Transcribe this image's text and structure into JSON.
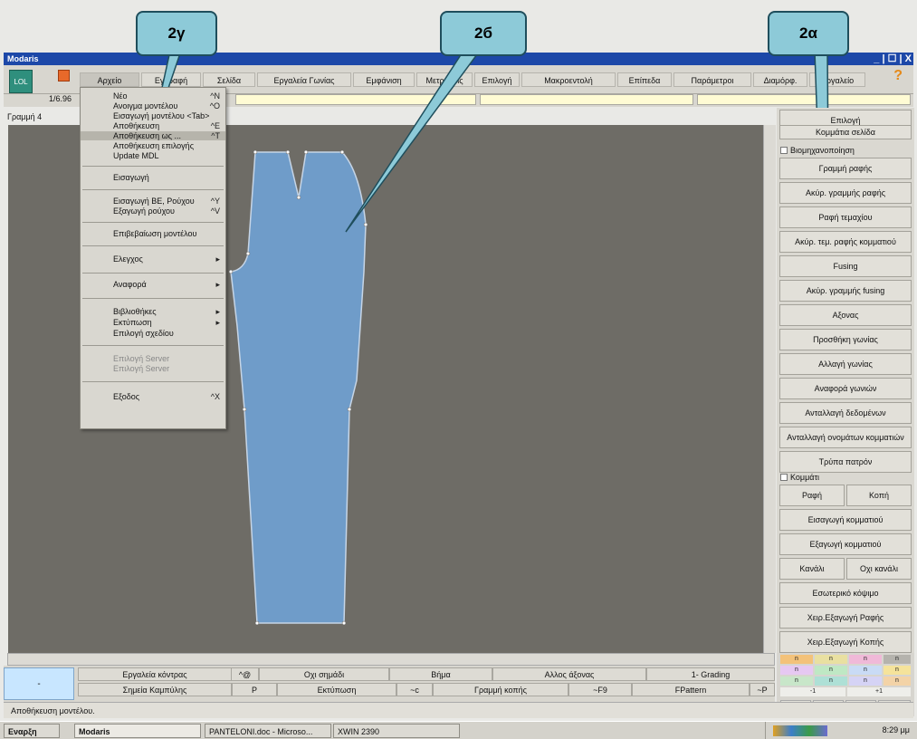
{
  "window": {
    "title": "Modaris",
    "controls": "_ | ☐ | X"
  },
  "menubar": {
    "lol": "LOL",
    "items": [
      "Αρχείο",
      "Εγγραφή",
      "Σελίδα",
      "Εργαλεία Γωνίας",
      "Εμφάνιση",
      "Μετρήσεις",
      "Επιλογή",
      "Μακροεντολή",
      "Επίπεδα",
      "Παράμετροι",
      "Διαμόρφ.",
      "Εργαλείο"
    ],
    "help": "?"
  },
  "toolrow": {
    "ratio": "1/6.96"
  },
  "layer_label": "Γραμμή 4",
  "dropdown": {
    "items": [
      {
        "label": "Νέο",
        "shortcut": "^N"
      },
      {
        "label": "Ανοιγμα μοντέλου",
        "shortcut": "^O"
      },
      {
        "label": "Εισαγωγή μοντέλου <Tab>",
        "shortcut": ""
      },
      {
        "label": "Αποθήκευση",
        "shortcut": "^E"
      },
      {
        "label": "Αποθήκευση ως ...",
        "shortcut": "^T"
      },
      {
        "label": "Αποθήκευση επιλογής",
        "shortcut": ""
      },
      {
        "label": "Update MDL",
        "shortcut": ""
      },
      {
        "label": "Εισαγωγή",
        "shortcut": ""
      },
      {
        "label": "Εισαγωγή ΒΕ, Ρούχου",
        "shortcut": "^Y"
      },
      {
        "label": "Εξαγωγή ρούχου",
        "shortcut": "^V"
      },
      {
        "label": "Επιβεβαίωση μοντέλου",
        "shortcut": ""
      },
      {
        "label": "Ελεγχος",
        "shortcut": "▸"
      },
      {
        "label": "Αναφορά",
        "shortcut": "▸"
      },
      {
        "label": "Βιβλιοθήκες",
        "shortcut": "▸"
      },
      {
        "label": "Εκτύπωση",
        "shortcut": "▸"
      },
      {
        "label": "Επιλογή σχεδίου",
        "shortcut": ""
      },
      {
        "label": "Επιλογή Server",
        "shortcut": ""
      },
      {
        "label": "Επιλογή Server",
        "shortcut": ""
      },
      {
        "label": "Εξοδος",
        "shortcut": "^X"
      }
    ]
  },
  "right_panel": {
    "buttons": [
      "Επιλογή",
      "Κομμάτια σελίδα",
      "Βιομηχανοποίηση",
      "Γραμμή ραφής",
      "Ακύρ. γραμμής ραφής",
      "Ραφή τεμαχίου",
      "Ακύρ. τεμ. ραφής κομματιού",
      "Fusing",
      "Ακύρ. γραμμής fusing",
      "Αξονας",
      "Προσθήκη γωνίας",
      "Αλλαγή γωνίας",
      "Αναφορά γωνιών",
      "Ανταλλαγή δεδομένων",
      "Ανταλλαγή ονομάτων κομματιών",
      "Τρύπα πατρόν",
      "Κομμάτι",
      "Ραφή",
      "Κοπή",
      "Εισαγωγή κομματιού",
      "Εξαγωγή κομματιού",
      "Κανάλι",
      "Οχι κανάλι",
      "Εσωτερικό κόψιμο",
      "Χειρ.Εξαγωγή Ραφής",
      "Χειρ.Εξαγωγή Κοπής"
    ]
  },
  "bottom": {
    "blue_label": "-",
    "row1": [
      "Εργαλεία κόντρας",
      "^@",
      "Οχι σημάδι",
      "Βήμα",
      "Αλλος άξονας",
      "1- Grading"
    ],
    "row2": [
      "Σημεία Καμπύλης",
      "P",
      "Εκτύπωση",
      "~c",
      "Γραμμή κοπής",
      "~F9",
      "FPattern",
      "~P"
    ]
  },
  "palette": {
    "codes": [
      "n",
      "n",
      "n",
      "n",
      "n",
      "n",
      "n",
      "n",
      "n",
      "n",
      "n",
      "n",
      "-1",
      "+1",
      "-",
      "-",
      "-",
      "-"
    ]
  },
  "status": "Αποθήκευση μοντέλου.",
  "taskbar": {
    "start": "Εναρξη",
    "tasks": [
      "Modaris",
      "PANTELONI.doc - Microso...",
      "XWIN 2390"
    ],
    "clock": "8:29 μμ"
  },
  "callouts": [
    "2γ",
    "2б",
    "2α"
  ],
  "colors": {
    "canvas": "#6e6c66",
    "piece_fill": "#6f9cc9",
    "callout": "#8dcad8",
    "titlebar": "#1d48a8"
  }
}
